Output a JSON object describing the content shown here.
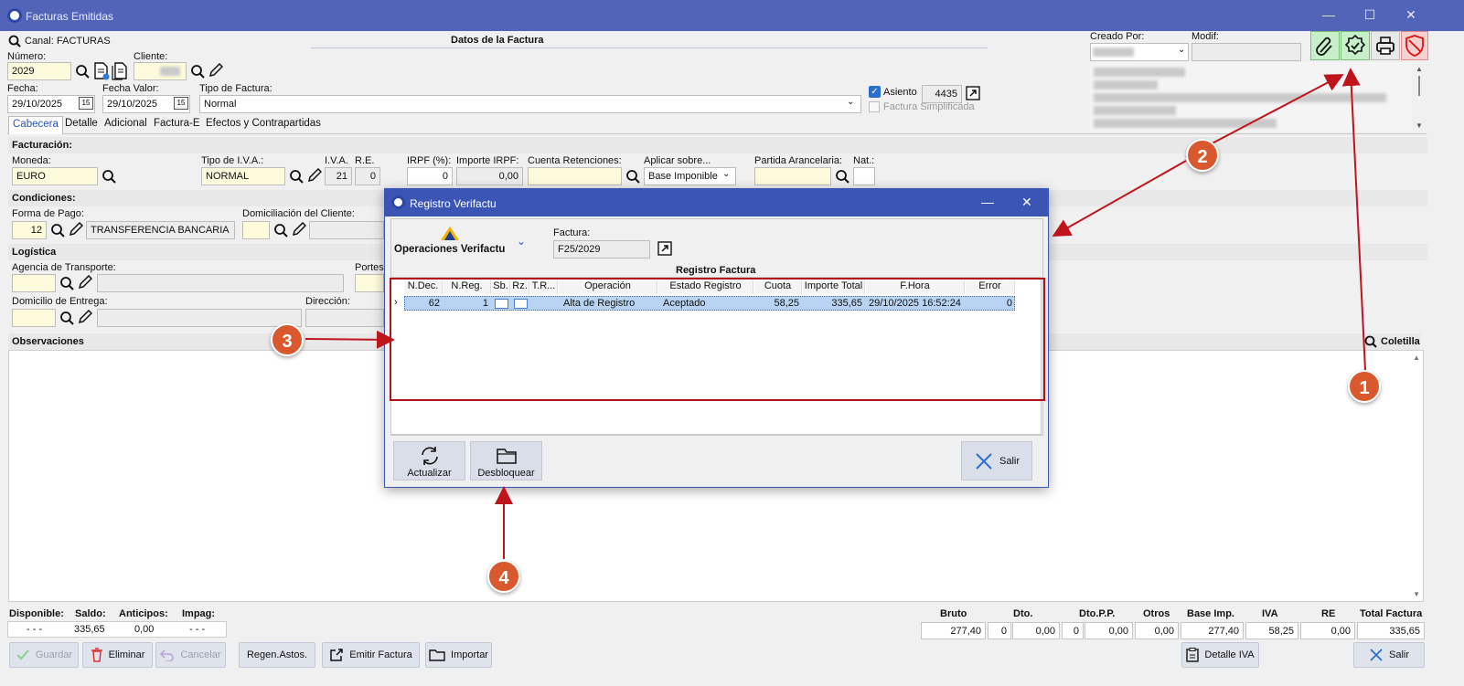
{
  "window": {
    "title": "Facturas Emitidas",
    "minimize": "—",
    "maximize": "☐",
    "close": "✕"
  },
  "header": {
    "canal_label": "Canal:",
    "canal_value": "FACTURAS",
    "section_title": "Datos de la Factura",
    "numero_label": "Número:",
    "numero_value": "2029",
    "cliente_label": "Cliente:",
    "fecha_label": "Fecha:",
    "fecha_value": "29/10/2025",
    "fecha_valor_label": "Fecha Valor:",
    "fecha_valor_value": "29/10/2025",
    "tipo_factura_label": "Tipo de Factura:",
    "tipo_factura_value": "Normal",
    "asiento_label": "Asiento",
    "asiento_value": "4435",
    "factura_simplificada_label": "Factura Simplificada",
    "creado_por_label": "Creado Por:",
    "modif_label": "Modif:"
  },
  "tabs": [
    "Cabecera",
    "Detalle",
    "Adicional",
    "Factura-E",
    "Efectos y Contrapartidas"
  ],
  "facturacion": {
    "section": "Facturación:",
    "moneda_label": "Moneda:",
    "moneda_value": "EURO",
    "tipo_iva_label": "Tipo de I.V.A.:",
    "tipo_iva_value": "NORMAL",
    "iva_label": "I.V.A.",
    "iva_value": "21",
    "re_label": "R.E.",
    "re_value": "0",
    "irpf_label": "IRPF (%):",
    "irpf_value": "0",
    "importe_irpf_label": "Importe IRPF:",
    "importe_irpf_value": "0,00",
    "cuenta_ret_label": "Cuenta Retenciones:",
    "aplicar_label": "Aplicar sobre...",
    "aplicar_value": "Base Imponible",
    "partida_label": "Partida Arancelaria:",
    "nat_label": "Nat.:"
  },
  "condiciones": {
    "section": "Condiciones:",
    "forma_pago_label": "Forma de Pago:",
    "forma_pago_code": "12",
    "forma_pago_value": "TRANSFERENCIA BANCARIA",
    "domiciliacion_label": "Domiciliación del Cliente:"
  },
  "logistica": {
    "section": "Logística",
    "agencia_label": "Agencia de Transporte:",
    "portes_label": "Portes:",
    "domicilio_label": "Domicilio de Entrega:",
    "direccion_label": "Dirección:"
  },
  "observaciones": {
    "section": "Observaciones",
    "coletilla": "Coletilla"
  },
  "footer_left": {
    "headers": [
      "Disponible:",
      "Saldo:",
      "Anticipos:",
      "Impag:"
    ],
    "values": [
      "- - -",
      "335,65",
      "0,00",
      "- - -"
    ]
  },
  "totals": {
    "headers": [
      "Bruto",
      "Dto.",
      "Dto.P.P.",
      "Otros",
      "Base Imp.",
      "IVA",
      "RE",
      "Total Factura"
    ],
    "bruto": "277,40",
    "dto_pct": "0",
    "dto": "0,00",
    "dtopp_pct": "0",
    "dtopp": "0,00",
    "otros": "0,00",
    "base": "277,40",
    "iva": "58,25",
    "re": "0,00",
    "total": "335,65"
  },
  "buttons": {
    "guardar": "Guardar",
    "eliminar": "Eliminar",
    "cancelar": "Cancelar",
    "regen": "Regen.Astos.",
    "emitir": "Emitir Factura",
    "importar": "Importar",
    "detalle_iva": "Detalle IVA",
    "salir": "Salir"
  },
  "dialog": {
    "title": "Registro Verifactu",
    "ops_label": "Operaciones Verifactu",
    "factura_label": "Factura:",
    "factura_value": "F25/2029",
    "grid_title": "Registro Factura",
    "columns": [
      "N.Dec.",
      "N.Reg.",
      "Sb.",
      "Rz.",
      "T.R...",
      "Operación",
      "Estado Registro",
      "Cuota",
      "Importe Total",
      "F.Hora",
      "Error"
    ],
    "row": {
      "ndec": "62",
      "nreg": "1",
      "operacion": "Alta de Registro",
      "estado": "Aceptado",
      "cuota": "58,25",
      "importe": "335,65",
      "fhora": "29/10/2025 16:52:24",
      "error": "0"
    },
    "actualizar": "Actualizar",
    "desbloquear": "Desbloquear",
    "salir": "Salir"
  },
  "callouts": [
    "1",
    "2",
    "3",
    "4"
  ],
  "colors": {
    "titlebar": "#5264b8",
    "dialog_titlebar": "#3b55b5",
    "callout": "#d9582e",
    "arrow": "#c0141c",
    "highlight_row": "#b9d4f2"
  }
}
